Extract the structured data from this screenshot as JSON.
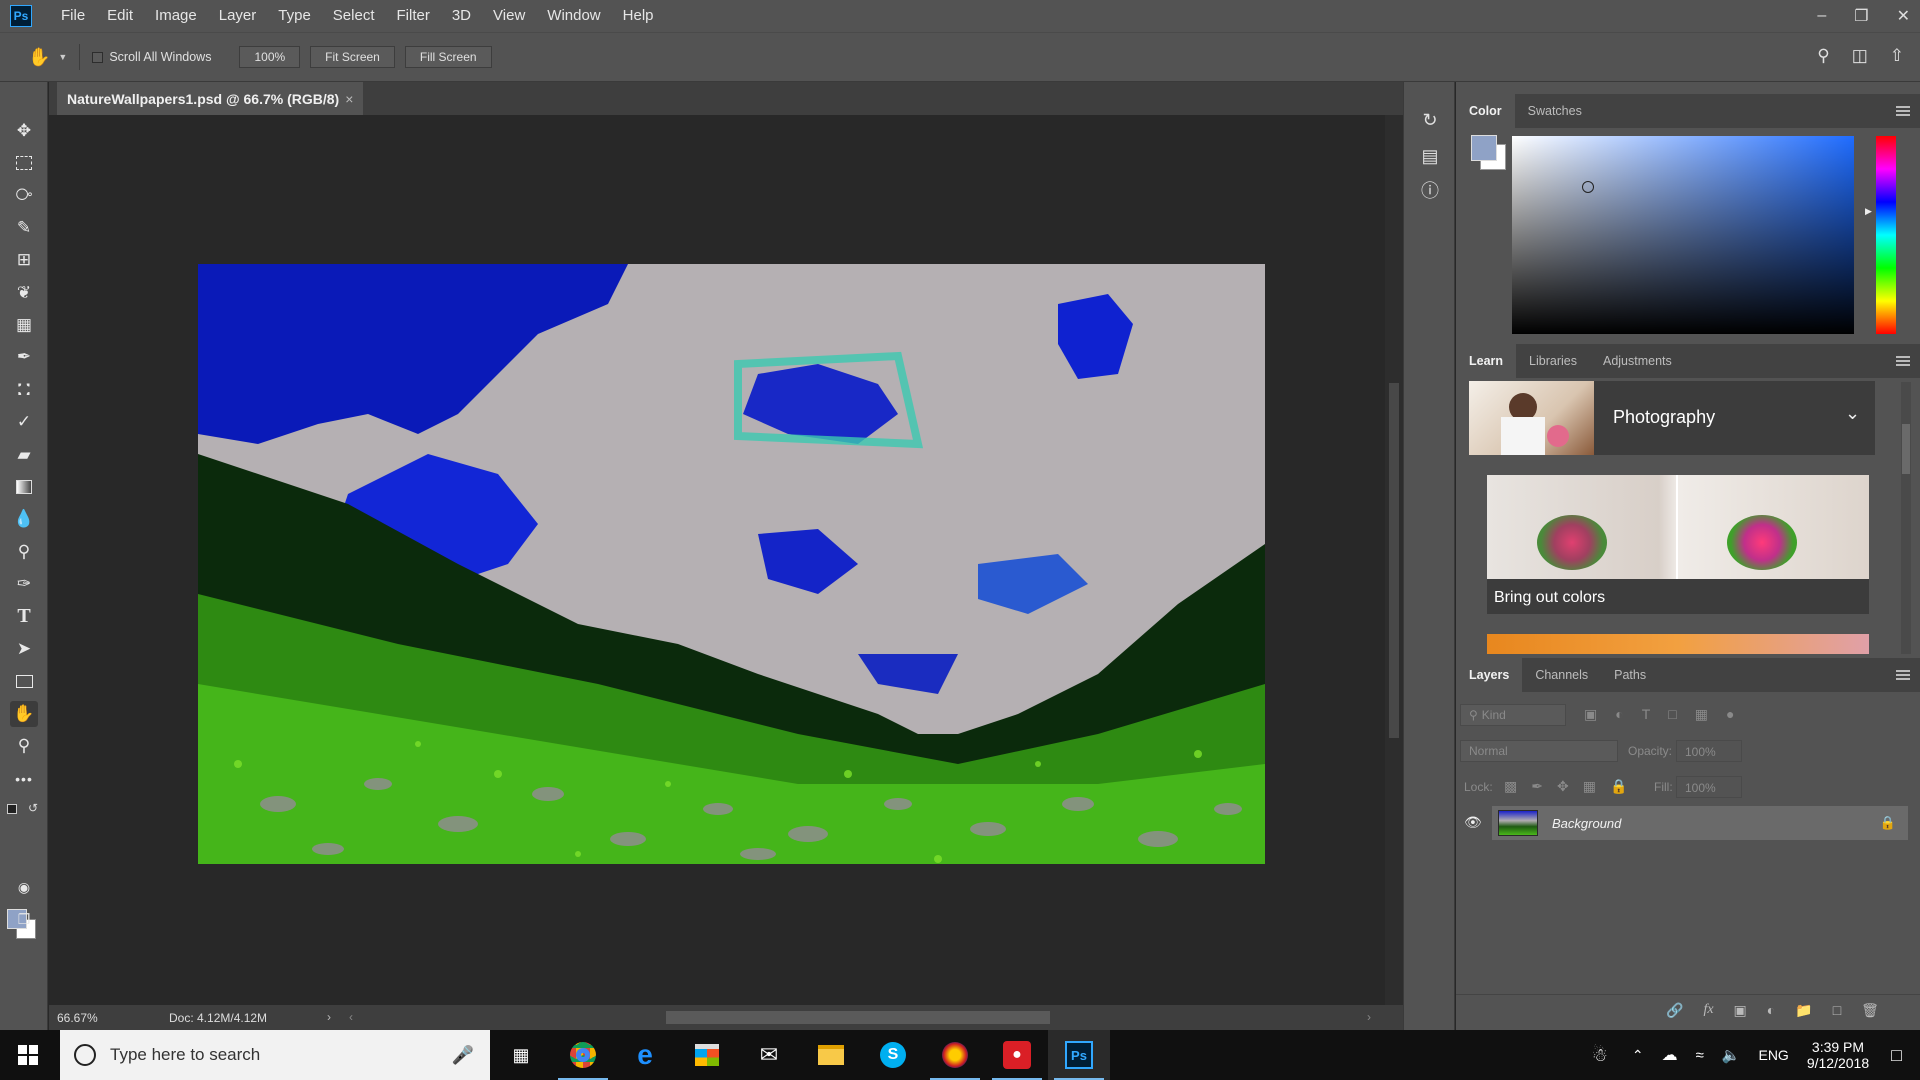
{
  "app": {
    "logo": "Ps"
  },
  "menu": [
    "File",
    "Edit",
    "Image",
    "Layer",
    "Type",
    "Select",
    "Filter",
    "3D",
    "View",
    "Window",
    "Help"
  ],
  "options_bar": {
    "scroll_all_windows": "Scroll All Windows",
    "zoom": "100%",
    "fit_screen": "Fit Screen",
    "fill_screen": "Fill Screen"
  },
  "document": {
    "tab_title": "NatureWallpapers1.psd @ 66.7% (RGB/8)",
    "zoom_status": "66.67%",
    "doc_status": "Doc: 4.12M/4.12M"
  },
  "color_panel": {
    "tabs": [
      "Color",
      "Swatches"
    ],
    "fg_color": "#8fa2c6",
    "bg_color": "#ffffff"
  },
  "learn_panel": {
    "tabs": [
      "Learn",
      "Libraries",
      "Adjustments"
    ],
    "category": "Photography",
    "tutorial_title": "Bring out colors"
  },
  "layers_panel": {
    "tabs": [
      "Layers",
      "Channels",
      "Paths"
    ],
    "kind_label": "Kind",
    "blend_mode": "Normal",
    "opacity_label": "Opacity:",
    "opacity_value": "100%",
    "lock_label": "Lock:",
    "fill_label": "Fill:",
    "fill_value": "100%",
    "layers": [
      {
        "name": "Background"
      }
    ]
  },
  "taskbar": {
    "search_placeholder": "Type here to search",
    "language": "ENG",
    "time": "3:39 PM",
    "date": "9/12/2018"
  }
}
